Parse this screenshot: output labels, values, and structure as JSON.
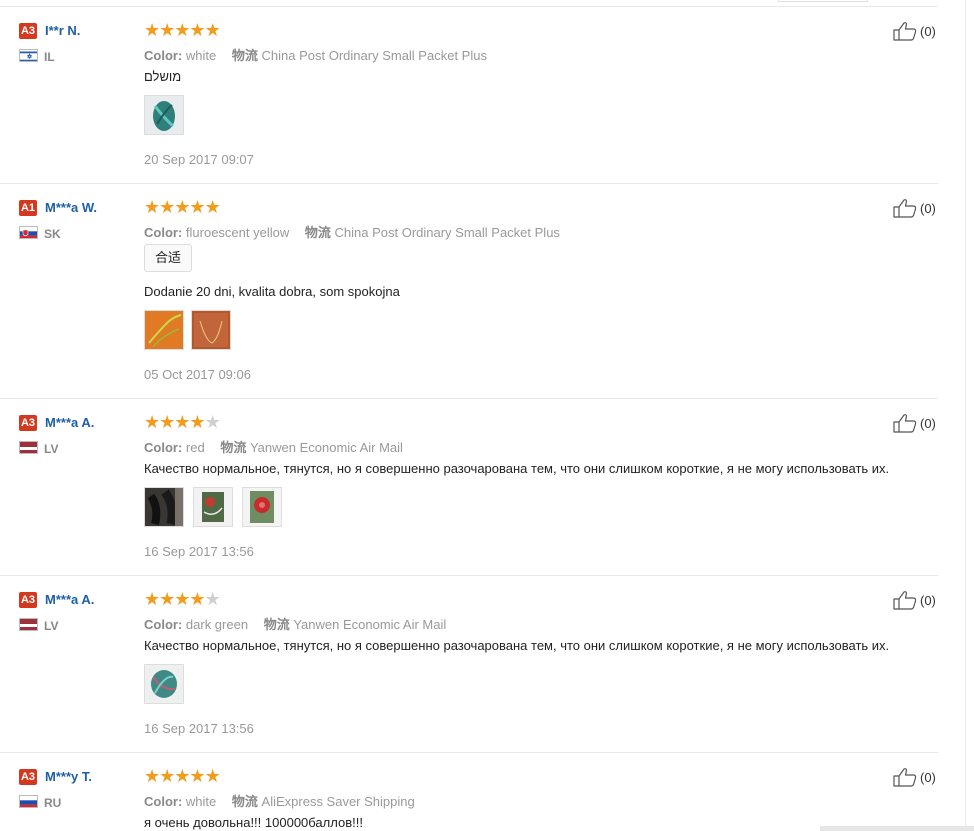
{
  "labels": {
    "color_key": "Color:",
    "shipping_key": "物流"
  },
  "reviews": [
    {
      "level": "A3",
      "user": "I**r N.",
      "country": "IL",
      "rating": 5,
      "color": "white",
      "shipping": "China Post Ordinary Small Packet Plus",
      "tag": "",
      "comment": "מושלם",
      "photo_count": 1,
      "date": "20 Sep 2017 09:07",
      "likes": "(0)"
    },
    {
      "level": "A1",
      "user": "M***a W.",
      "country": "SK",
      "rating": 5,
      "color": "fluroescent yellow",
      "shipping": "China Post Ordinary Small Packet Plus",
      "tag": "合适",
      "comment": "Dodanie 20 dni, kvalita dobra, som spokojna",
      "photo_count": 2,
      "date": "05 Oct 2017 09:06",
      "likes": "(0)"
    },
    {
      "level": "A3",
      "user": "M***a A.",
      "country": "LV",
      "rating": 4,
      "color": "red",
      "shipping": "Yanwen Economic Air Mail",
      "tag": "",
      "comment": "Качество нормальное, тянутся, но я совершенно разочарована тем, что они слишком короткие, я не могу использовать их.",
      "photo_count": 3,
      "date": "16 Sep 2017 13:56",
      "likes": "(0)"
    },
    {
      "level": "A3",
      "user": "M***a A.",
      "country": "LV",
      "rating": 4,
      "color": "dark green",
      "shipping": "Yanwen Economic Air Mail",
      "tag": "",
      "comment": "Качество нормальное, тянутся, но я совершенно разочарована тем, что они слишком короткие, я не могу использовать их.",
      "photo_count": 1,
      "date": "16 Sep 2017 13:56",
      "likes": "(0)"
    },
    {
      "level": "A3",
      "user": "M***y T.",
      "country": "RU",
      "rating": 5,
      "color": "white",
      "shipping": "AliExpress Saver Shipping",
      "tag": "",
      "comment": "я очень довольна!!! 100000баллов!!!",
      "photo_count": 0,
      "date": "",
      "likes": "(0)"
    }
  ],
  "colors": {
    "badge": "#d4391f",
    "username": "#1f5ea8",
    "star_on": "#f39c1c",
    "star_off": "#cfcfcf",
    "meta_text": "#999999"
  }
}
